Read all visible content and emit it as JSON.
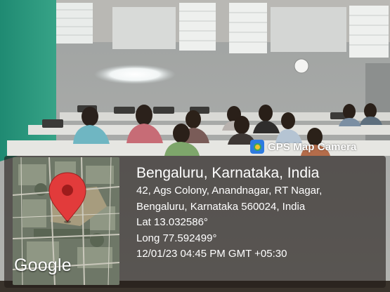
{
  "badge": {
    "label": "GPS Map Camera",
    "icon": "gps-map-camera-icon"
  },
  "map": {
    "attribution": "Google",
    "icon": "location-pin-icon",
    "pin_color": "#e23b3b"
  },
  "location": {
    "title": "Bengaluru, Karnataka, India",
    "address_line1": "42, Ags Colony, Anandnagar, RT Nagar,",
    "address_line2": "Bengaluru, Karnataka 560024, India",
    "latitude": "Lat 13.032586°",
    "longitude": "Long 77.592499°",
    "datetime": "12/01/23 04:45 PM GMT +05:30"
  },
  "colors": {
    "wall_green": "#2f9b80",
    "wall_gray": "#a8aaa8",
    "overlay": "#221c18"
  }
}
